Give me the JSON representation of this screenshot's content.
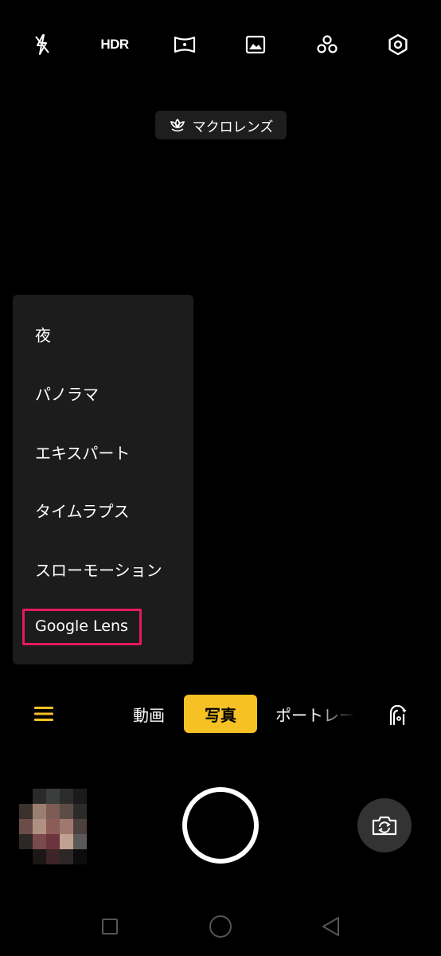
{
  "top_bar": {
    "flash_icon": "flash-off-icon",
    "hdr_label": "HDR",
    "panorama_icon": "wide-angle-icon",
    "filter_icon": "image-filter-icon",
    "beauty_icon": "three-circles-icon",
    "settings_icon": "gear-icon"
  },
  "macro_chip": {
    "icon": "flower-icon",
    "label": "マクロレンズ"
  },
  "mode_menu": {
    "items": [
      {
        "label": "夜"
      },
      {
        "label": "パノラマ"
      },
      {
        "label": "エキスパート"
      },
      {
        "label": "タイムラプス"
      },
      {
        "label": "スローモーション"
      },
      {
        "label": "Google Lens"
      }
    ],
    "highlighted": "Google Lens"
  },
  "mode_bar": {
    "menu_icon": "hamburger-menu-icon",
    "modes": [
      {
        "label": "動画"
      },
      {
        "label": "写真",
        "active": true
      },
      {
        "label": "ポートレー"
      }
    ],
    "ai_icon": "ai-face-icon"
  },
  "bottom": {
    "gallery_thumbnail": "pixelated-photo-thumbnail",
    "shutter": "shutter-button",
    "flip_icon": "camera-flip-icon"
  },
  "nav_bar": {
    "recent_icon": "square-icon",
    "home_icon": "circle-icon",
    "back_icon": "triangle-back-icon"
  },
  "colors": {
    "accent": "#f5c124",
    "highlight": "#e5195e",
    "panel": "#1c1c1c",
    "background": "#000000"
  }
}
